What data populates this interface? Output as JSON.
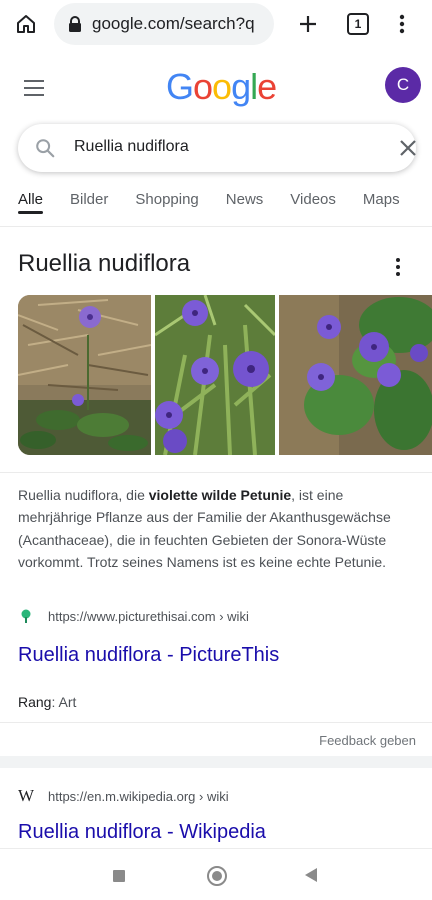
{
  "browser": {
    "url": "google.com/search?q",
    "tab_count": "1",
    "icons": [
      "home-icon",
      "lock-icon",
      "plus-icon",
      "tabs-icon",
      "more-vert-icon"
    ]
  },
  "header": {
    "logo_letters": [
      "G",
      "o",
      "o",
      "g",
      "l",
      "e"
    ],
    "avatar_initial": "C"
  },
  "search": {
    "query": "Ruellia nudiflora"
  },
  "tabs": [
    {
      "label": "Alle",
      "active": true
    },
    {
      "label": "Bilder"
    },
    {
      "label": "Shopping"
    },
    {
      "label": "News"
    },
    {
      "label": "Videos"
    },
    {
      "label": "Maps"
    }
  ],
  "knowledge_panel": {
    "title": "Ruellia nudiflora",
    "description_before": "Ruellia nudiflora, die ",
    "description_bold": "violette wilde Petunie",
    "description_after": ", ist eine mehrjährige Pflanze aus der Familie der Akanthusgewächse (Acanthaceae), die in feuchten Gebieten der Sonora-Wüste vorkommt. Trotz seines Namens ist es keine echte Petunie.",
    "source_url": "https://www.picturethisai.com › wiki",
    "link_title": "Ruellia nudiflora - PictureThis",
    "rank_label": "Rang",
    "rank_value": "Art",
    "feedback": "Feedback geben"
  },
  "wiki_result": {
    "source_url": "https://en.m.wikipedia.org › wiki",
    "link_title": "Ruellia nudiflora - Wikipedia"
  },
  "colors": {
    "link": "#1a0dab",
    "avatar": "#5b2aa6",
    "flower": "#7b5bd6"
  }
}
